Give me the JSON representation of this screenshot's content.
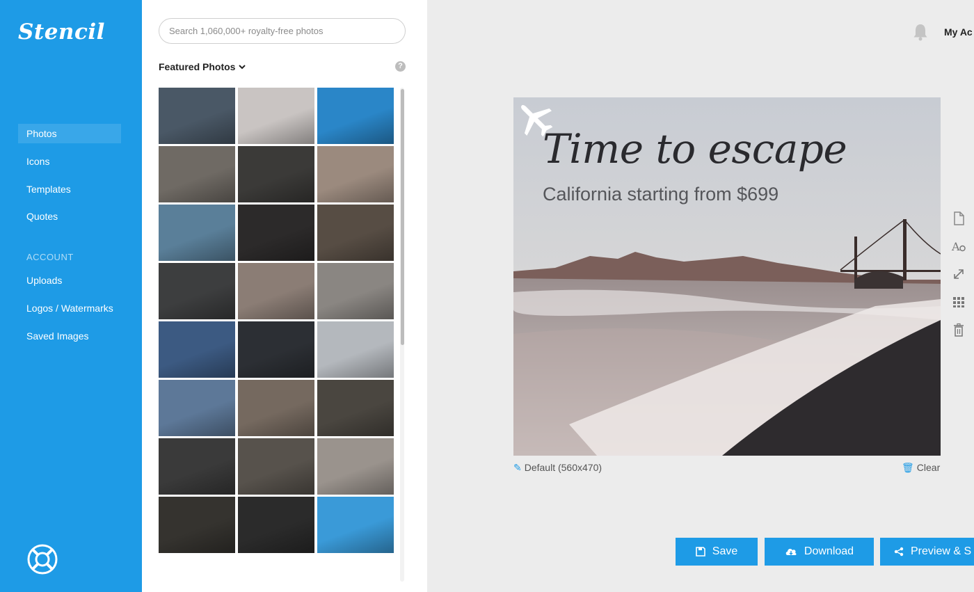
{
  "app": {
    "logo": "Stencil"
  },
  "sidebar": {
    "items": [
      {
        "label": "Photos",
        "active": true
      },
      {
        "label": "Icons"
      },
      {
        "label": "Templates"
      },
      {
        "label": "Quotes"
      }
    ],
    "account_heading": "ACCOUNT",
    "account_items": [
      {
        "label": "Uploads"
      },
      {
        "label": "Logos / Watermarks"
      },
      {
        "label": "Saved Images"
      }
    ],
    "help_icon": "lifebuoy-icon"
  },
  "photos": {
    "search_placeholder": "Search 1,060,000+ royalty-free photos",
    "section_label": "Featured Photos",
    "help_glyph": "?",
    "thumbnail_count": 24,
    "thumb_colors": [
      "#4a5866",
      "#c9c4c2",
      "#2a86c8",
      "#6f6a64",
      "#3b3a38",
      "#9b8a7e",
      "#5a7f99",
      "#2c2a2a",
      "#574d44",
      "#3d3e3f",
      "#8b7d75",
      "#8a8682",
      "#3c5a82",
      "#2c2f34",
      "#b4b8bd",
      "#5d7898",
      "#75695f",
      "#4a4640",
      "#3a3a3a",
      "#57524c",
      "#9a938d",
      "#35332f",
      "#2b2b2b",
      "#3a9ad8"
    ]
  },
  "header": {
    "account_label": "My Ac",
    "bell_icon": "bell-icon"
  },
  "canvas": {
    "headline": "Time to escape",
    "subline": "California starting from $699",
    "size_label": "Default (560x470)",
    "clear_label": "Clear",
    "plane_icon": "airplane-icon"
  },
  "toolbar": [
    "page-icon",
    "text-style-icon",
    "resize-icon",
    "grid-icon",
    "trash-icon"
  ],
  "actions": {
    "save": "Save",
    "download": "Download",
    "preview": "Preview & S"
  },
  "colors": {
    "accent": "#1e9be6",
    "sidebar": "#1e9be6"
  }
}
